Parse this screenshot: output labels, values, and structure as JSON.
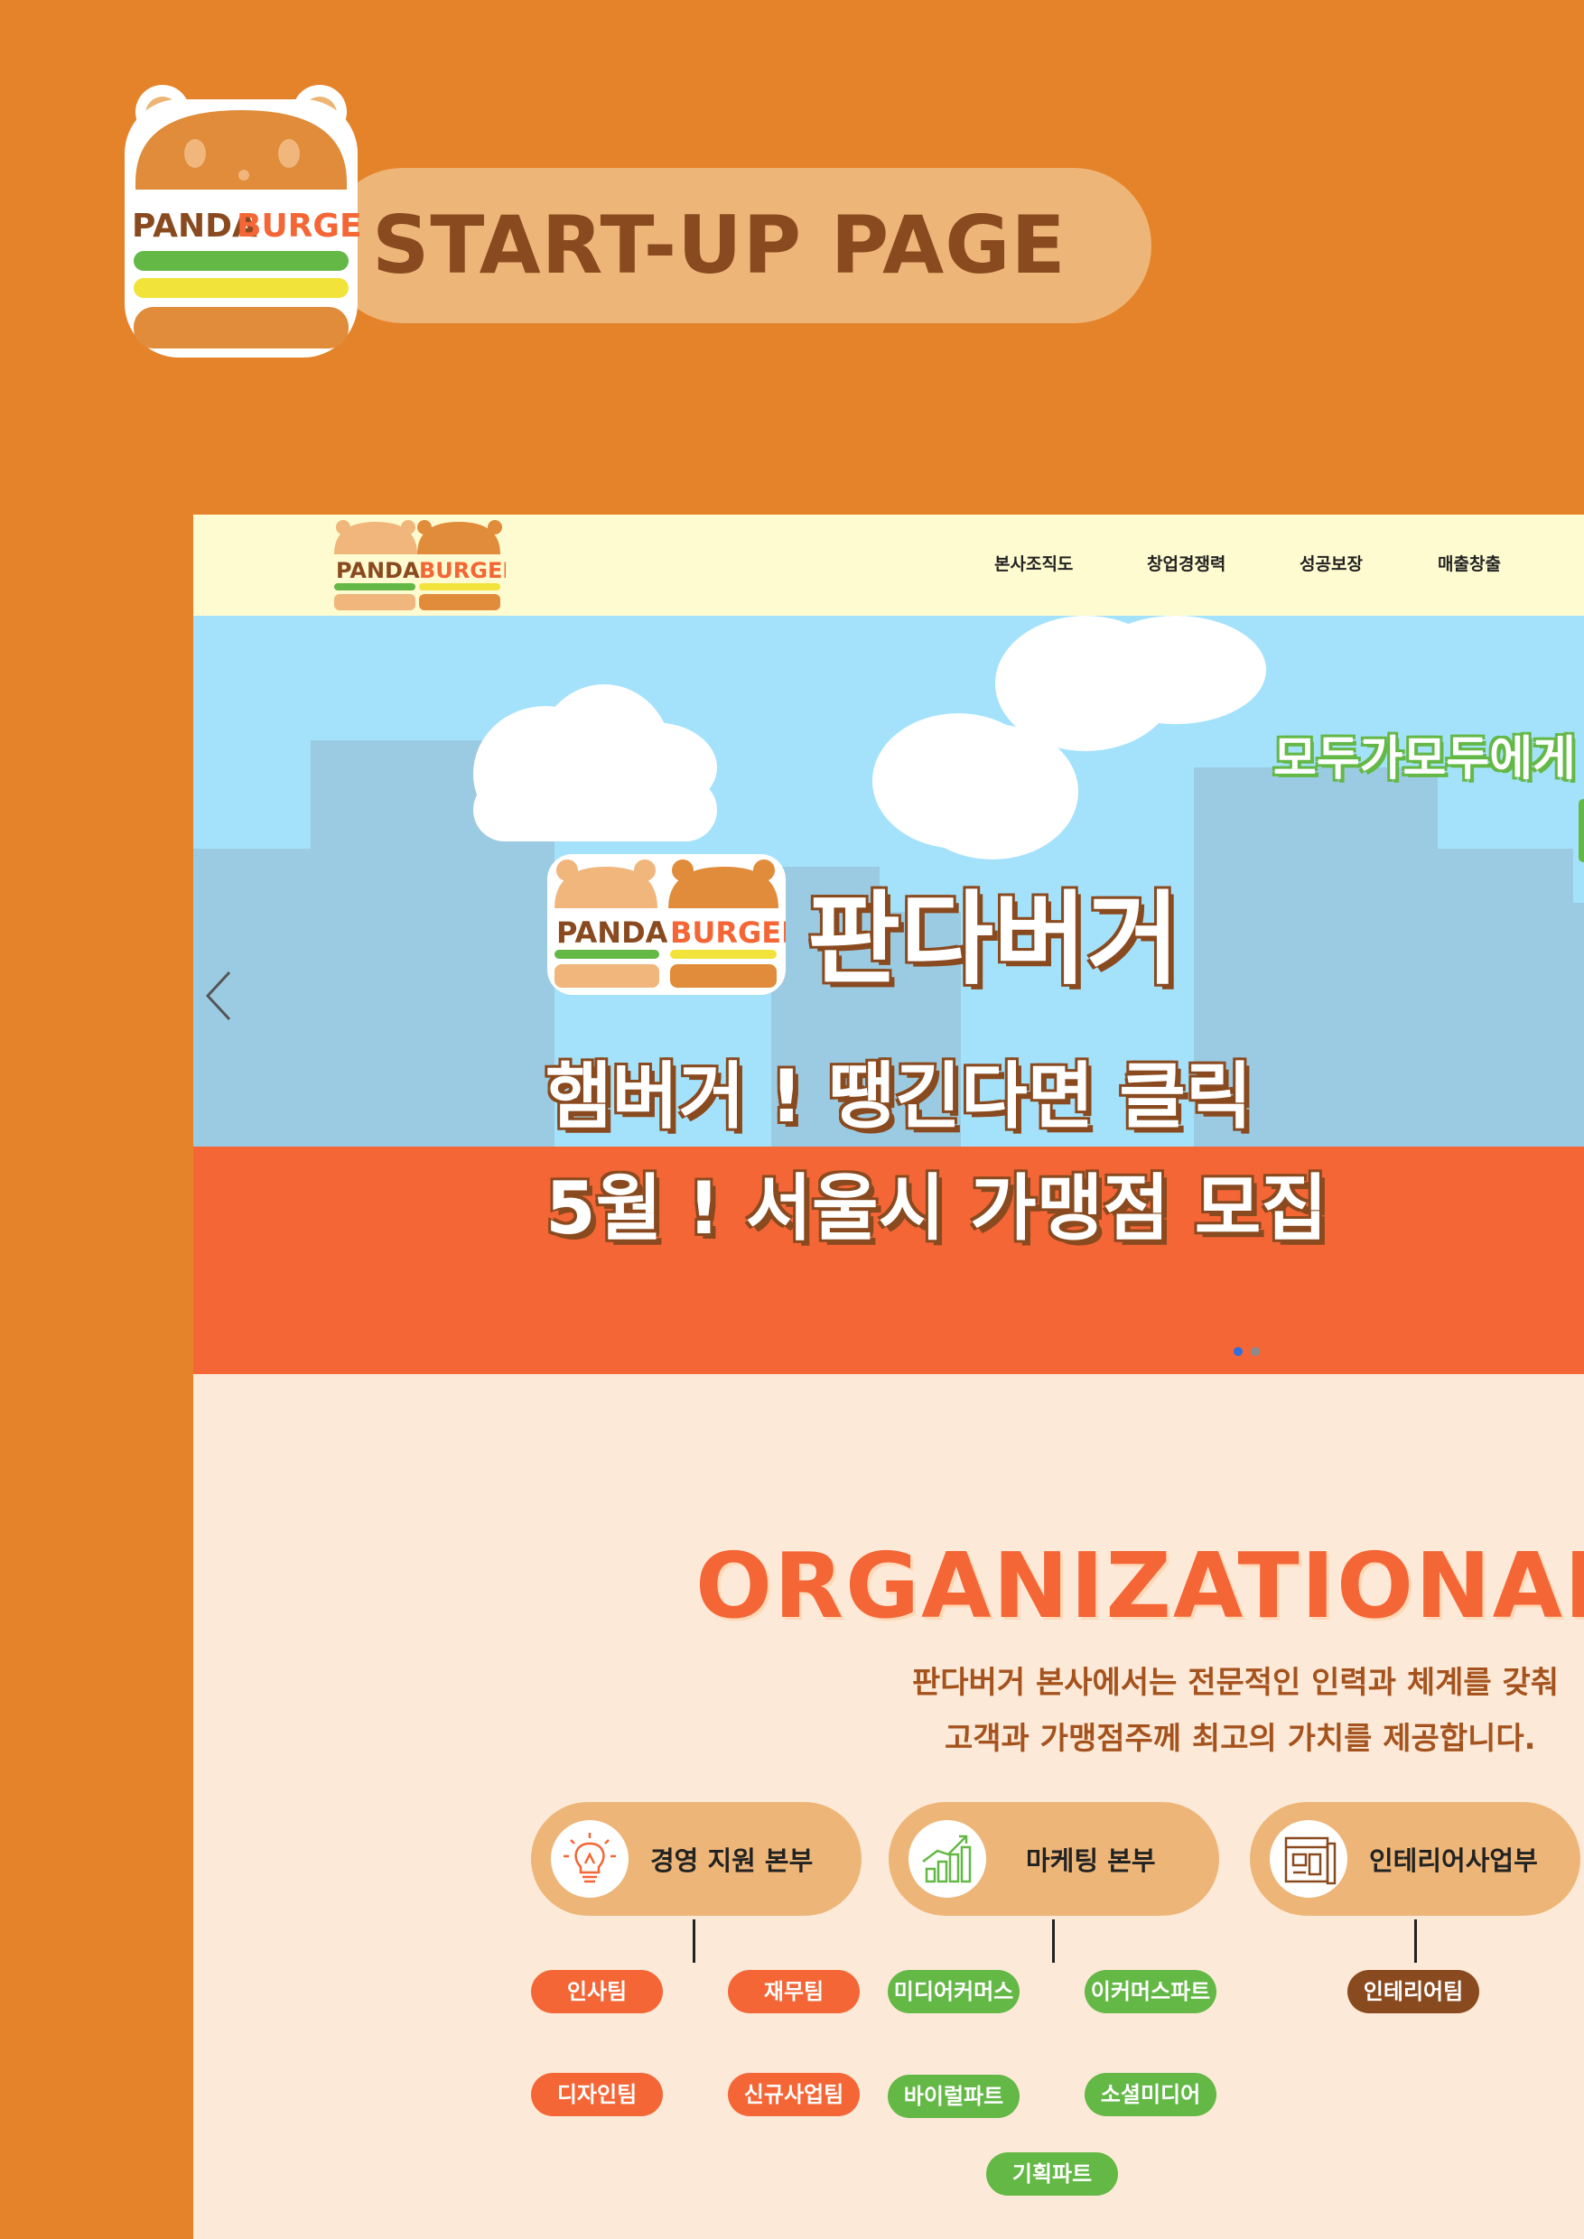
{
  "header": {
    "logo_text_1": "PANDA",
    "logo_text_2": "BURGER",
    "title": "START-UP PAGE"
  },
  "nav": {
    "logo_text_1": "PANDA",
    "logo_text_2": "BURGER",
    "items": [
      {
        "label": "본사조직도"
      },
      {
        "label": "창업경쟁력"
      },
      {
        "label": "성공보장"
      },
      {
        "label": "매출창출"
      }
    ]
  },
  "hero": {
    "logo_text_1": "PANDA",
    "logo_text_2": "BURGER",
    "brand": "판다버거",
    "line1": "햄버거 ! 땡긴다면 클릭",
    "line2": "5월 ! 서울시 가맹점 모집",
    "side_text": "모두가모두에게",
    "dots": {
      "active": 0,
      "count": 2
    }
  },
  "org": {
    "title": "ORGANIZATIONAL CH",
    "desc1": "판다버거 본사에서는 전문적인 인력과 체계를 갖춰",
    "desc2": "고객과 가맹점주께 최고의 가치를 제공합니다.",
    "departments": [
      {
        "label": "경영 지원 본부",
        "icon": "lightbulb-icon",
        "teams": [
          "인사팀",
          "재무팀",
          "디자인팀",
          "신규사업팀"
        ]
      },
      {
        "label": "마케팅 본부",
        "icon": "chart-growth-icon",
        "teams": [
          "미디어커머스",
          "이커머스파트",
          "바이럴파트",
          "소셜미디어",
          "기획파트"
        ]
      },
      {
        "label": "인테리어사업부",
        "icon": "blueprint-icon",
        "teams": [
          "인테리어팀"
        ]
      }
    ]
  },
  "colors": {
    "page_bg": "#e5832a",
    "title_pill": "#edb678",
    "brown": "#8a4a1f",
    "nav_bg": "#fffbd0",
    "sky": "#a4e2fc",
    "ground": "#f46636",
    "section_bg": "#fde9d7",
    "team_orange": "#f46636",
    "team_green": "#63b846",
    "team_brown": "#8a4a1f"
  }
}
